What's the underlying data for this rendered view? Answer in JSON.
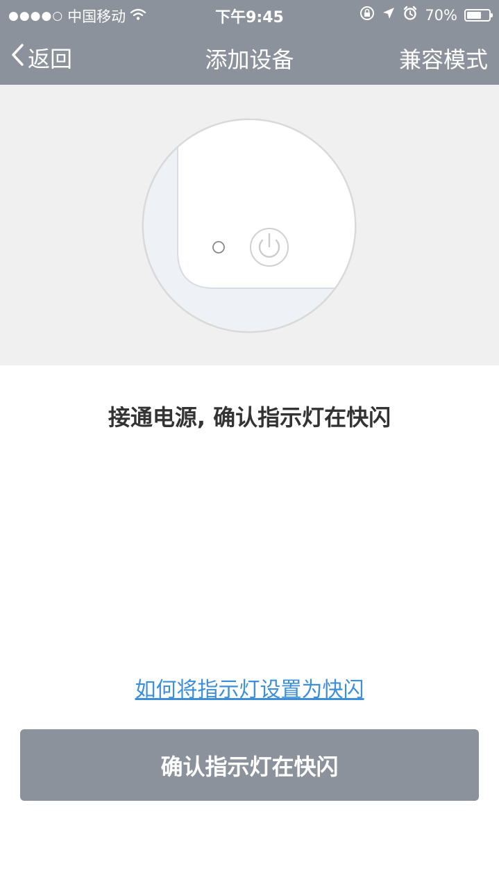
{
  "status_bar": {
    "signal_dots": "●●●●○",
    "carrier": "中国移动",
    "wifi_icon": "wifi-icon",
    "time": "下午9:45",
    "battery_text": "70%",
    "battery_level": 0.7
  },
  "nav": {
    "back_label": "返回",
    "title": "添加设备",
    "compat_label": "兼容模式"
  },
  "instruction": "接通电源, 确认指示灯在快闪",
  "help_link": "如何将指示灯设置为快闪",
  "confirm_button": "确认指示灯在快闪",
  "colors": {
    "bar_gray": "#8c929b",
    "illus_bg": "#f0f0f0",
    "link_blue": "#3d8fd8",
    "text_dark": "#333333"
  }
}
